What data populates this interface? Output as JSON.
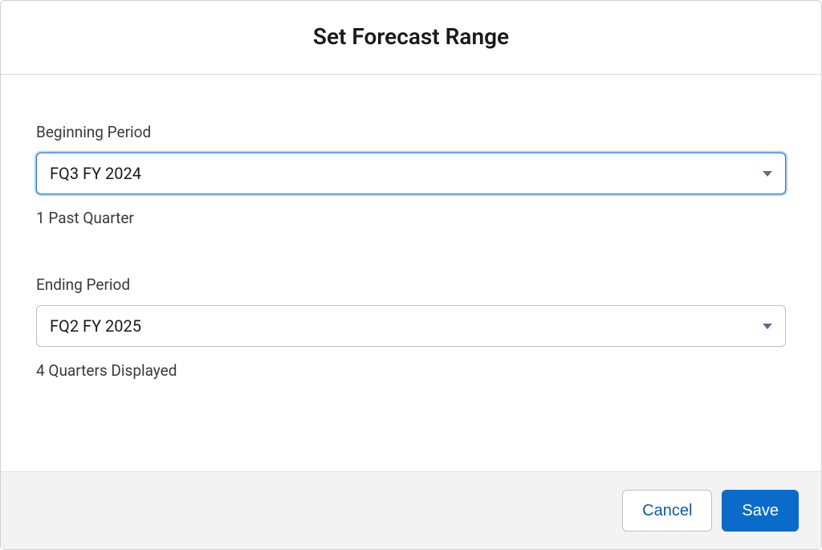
{
  "header": {
    "title": "Set Forecast Range"
  },
  "beginning": {
    "label": "Beginning Period",
    "value": "FQ3 FY 2024",
    "hint": "1 Past Quarter"
  },
  "ending": {
    "label": "Ending Period",
    "value": "FQ2 FY 2025",
    "hint": "4 Quarters Displayed"
  },
  "footer": {
    "cancel": "Cancel",
    "save": "Save"
  }
}
